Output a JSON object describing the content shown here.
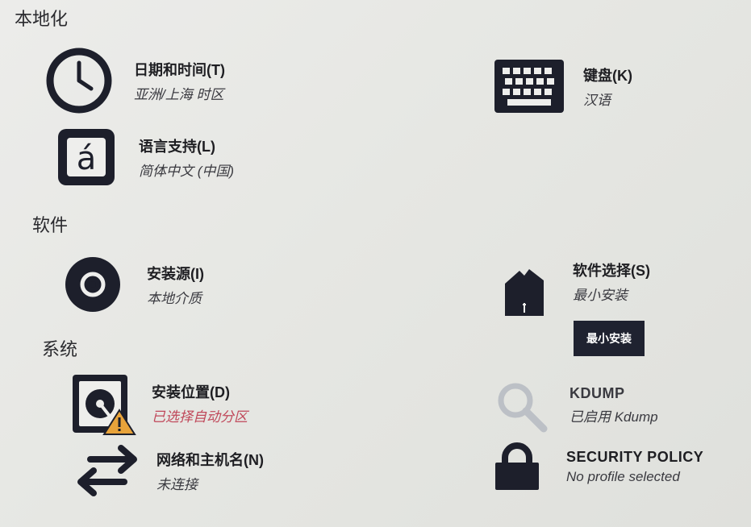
{
  "sections": {
    "localization": "本地化",
    "software": "软件",
    "system": "系统"
  },
  "spokes": {
    "datetime": {
      "title": "日期和时间(T)",
      "status": "亚洲/上海 时区",
      "icon": "clock-icon"
    },
    "keyboard": {
      "title": "键盘(K)",
      "status": "汉语",
      "icon": "keyboard-icon"
    },
    "language": {
      "title": "语言支持(L)",
      "status": "简体中文 (中国)",
      "icon": "language-icon",
      "glyph": "á"
    },
    "source": {
      "title": "安装源(I)",
      "status": "本地介质",
      "icon": "disc-icon"
    },
    "software": {
      "title": "软件选择(S)",
      "status": "最小安装",
      "icon": "package-icon"
    },
    "destination": {
      "title": "安装位置(D)",
      "status": "已选择自动分区",
      "icon": "harddisk-warning-icon"
    },
    "kdump": {
      "title": "KDUMP",
      "status": "已启用 Kdump",
      "icon": "search-icon"
    },
    "network": {
      "title": "网络和主机名(N)",
      "status": "未连接",
      "icon": "network-arrows-icon"
    },
    "security": {
      "title": "SECURITY POLICY",
      "status": "No profile selected",
      "icon": "lock-icon"
    }
  },
  "tooltip": {
    "label": "最小安装"
  },
  "colors": {
    "icon": "#1d1f2b",
    "warning": "#c0485a",
    "kdump_icon": "#bcc0c6",
    "tooltip_bg": "#1f2230"
  }
}
